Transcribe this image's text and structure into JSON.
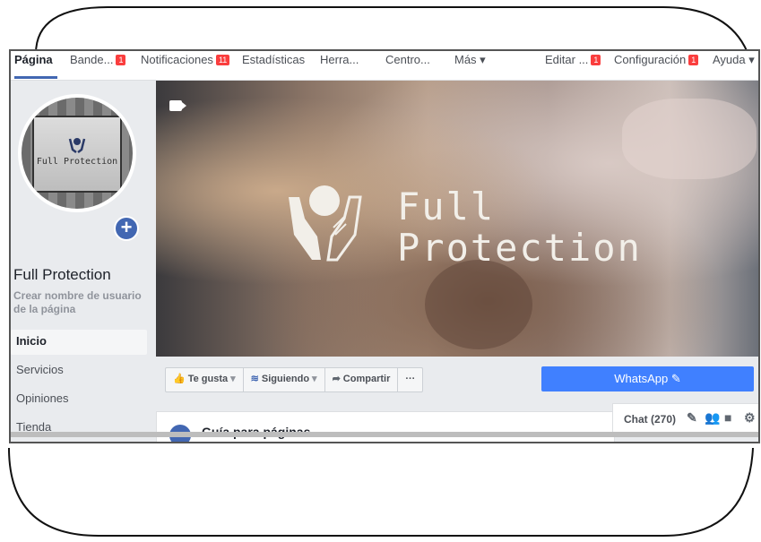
{
  "nav": {
    "tabs": [
      {
        "label": "Página",
        "badge": ""
      },
      {
        "label": "Bande...",
        "badge": "1"
      },
      {
        "label": "Notificaciones",
        "badge": "11"
      },
      {
        "label": "Estadísticas",
        "badge": ""
      },
      {
        "label": "Herra...",
        "badge": ""
      },
      {
        "label": "Centro...",
        "badge": ""
      },
      {
        "label": "Más ▾",
        "badge": ""
      },
      {
        "label": "Editar ...",
        "badge": "1"
      },
      {
        "label": "Configuración",
        "badge": "1"
      },
      {
        "label": "Ayuda ▾",
        "badge": ""
      }
    ]
  },
  "sidebar": {
    "page_name": "Full Protection",
    "username_prompt": "Crear nombre de usuario de la página",
    "avatar_text": "Full Protection",
    "items": [
      {
        "label": "Inicio"
      },
      {
        "label": "Servicios"
      },
      {
        "label": "Opiniones"
      },
      {
        "label": "Tienda"
      }
    ]
  },
  "cover": {
    "brand_line1": "Full",
    "brand_line2": "Protection"
  },
  "actions": {
    "like": "Te gusta",
    "following": "Siguiendo",
    "share": "Compartir",
    "more": "···",
    "whatsapp": "WhatsApp"
  },
  "guide": {
    "title": "Guía para páginas"
  },
  "chat": {
    "label": "Chat (270)"
  },
  "colors": {
    "accent": "#4267b2",
    "cta": "#4080ff",
    "badge": "#fa3e3e"
  },
  "icons": [
    "video-camera-icon",
    "plus-icon",
    "thumbs-up-icon",
    "rss-icon",
    "share-icon",
    "pencil-icon",
    "compose-icon",
    "people-icon",
    "video-call-icon",
    "gear-icon"
  ]
}
